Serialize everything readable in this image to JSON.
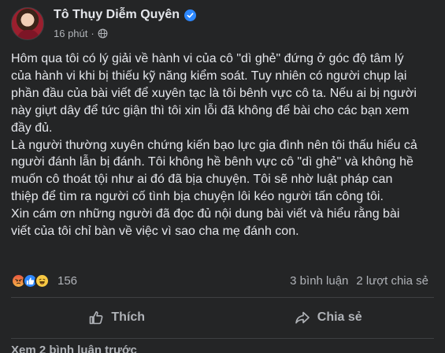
{
  "post": {
    "author": "Tô Thụy Diễm Quyên",
    "timestamp": "16 phút",
    "meta_separator": "·",
    "paragraphs": [
      "Hôm qua tôi có lý giải về hành vi của cô \"dì ghẻ\" đứng ở góc độ tâm lý của hành vi khi bị thiếu kỹ năng kiểm soát. Tuy nhiên có người chụp lại phần đầu của bài viết để xuyên tạc là tôi bênh vực cô ta. Nếu ai bị người này giựt dây để tức giận thì tôi xin lỗi đã không để bài cho các bạn xem đầy đủ.",
      "Là người thường xuyên chứng kiến bạo lực gia đình nên tôi thấu hiểu cả người đánh lẫn bị đánh. Tôi không hề bênh vực cô \"dì ghẻ\" và không hề muốn cô thoát tội như ai đó đã bịa chuyện. Tôi sẽ nhờ luật pháp can thiệp để tìm ra người cố tình bịa chuyện lôi kéo người tấn công tôi.",
      "Xin cám ơn những người đã đọc đủ nội dung bài viết và hiểu rằng bài viết của tôi chỉ bàn về việc vì sao cha mẹ đánh con."
    ]
  },
  "stats": {
    "reaction_count": "156",
    "comments": "3 bình luận",
    "shares": "2 lượt chia sẻ",
    "reaction_icons": [
      "angry-icon",
      "like-icon",
      "haha-icon"
    ]
  },
  "actions": {
    "like_label": "Thích",
    "share_label": "Chia sẻ"
  },
  "comments_link": "Xem 2 bình luận trước",
  "colors": {
    "background": "#242526",
    "text": "#e4e6eb",
    "secondary_text": "#b0b3b8",
    "verified_blue": "#2d88ff",
    "divider": "#3e4042"
  }
}
